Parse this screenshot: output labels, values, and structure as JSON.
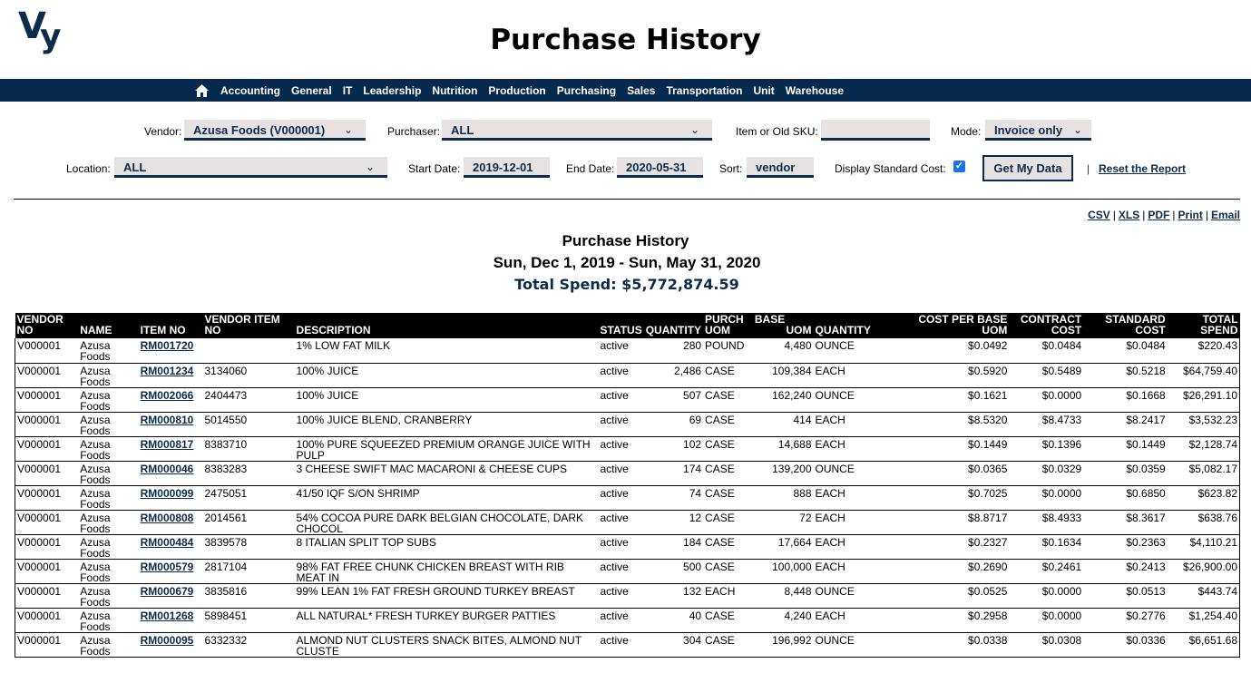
{
  "header": {
    "logo_text_v": "V",
    "logo_text_y": "y",
    "title": "Purchase History"
  },
  "nav": {
    "home_icon": "home-icon",
    "items": [
      "Accounting",
      "General",
      "IT",
      "Leadership",
      "Nutrition",
      "Production",
      "Purchasing",
      "Sales",
      "Transportation",
      "Unit",
      "Warehouse"
    ]
  },
  "filters": {
    "vendor_label": "Vendor:",
    "vendor_value": "Azusa Foods (V000001)",
    "purchaser_label": "Purchaser:",
    "purchaser_value": "ALL",
    "sku_label": "Item or Old SKU:",
    "sku_value": "",
    "mode_label": "Mode:",
    "mode_value": "Invoice only",
    "location_label": "Location:",
    "location_value": "ALL",
    "start_label": "Start Date:",
    "start_value": "2019-12-01",
    "end_label": "End Date:",
    "end_value": "2020-05-31",
    "sort_label": "Sort:",
    "sort_value": "vendor",
    "std_cost_label": "Display Standard Cost:",
    "std_cost_checked": true,
    "submit_label": "Get My Data",
    "separator": "|",
    "reset_label": "Reset the Report"
  },
  "exports": [
    "CSV",
    "XLS",
    "PDF",
    "Print",
    "Email"
  ],
  "report": {
    "title": "Purchase History",
    "range": "Sun, Dec 1, 2019 - Sun, May 31, 2020",
    "total": "Total Spend: $5,772,874.59"
  },
  "table": {
    "columns": [
      {
        "l1": "VENDOR",
        "l2": "NO"
      },
      {
        "l1": "",
        "l2": "NAME"
      },
      {
        "l1": "",
        "l2": "ITEM NO"
      },
      {
        "l1": "VENDOR ITEM",
        "l2": "NO"
      },
      {
        "l1": "",
        "l2": "DESCRIPTION"
      },
      {
        "l1": "",
        "l2": "STATUS"
      },
      {
        "l1": "",
        "l2": "QUANTITY"
      },
      {
        "l1": "PURCH",
        "l2": "UOM"
      },
      {
        "l1": "BASE",
        "l2": "UOM"
      },
      {
        "l1": "",
        "l2": "QUANTITY"
      },
      {
        "l1": "COST PER BASE",
        "l2": "UOM"
      },
      {
        "l1": "CONTRACT",
        "l2": "COST"
      },
      {
        "l1": "STANDARD",
        "l2": "COST"
      },
      {
        "l1": "TOTAL",
        "l2": "SPEND"
      }
    ],
    "rows": [
      {
        "vendor_no": "V000001",
        "name": "Azusa Foods",
        "item_no": "RM001720",
        "vendor_item_no": "",
        "description": "1% LOW FAT MILK",
        "status": "active",
        "quantity": "280",
        "purch_uom": "POUND",
        "base_uom": "4,480",
        "base_quantity": "OUNCE",
        "cost_per_base_uom": "$0.0492",
        "contract_cost": "$0.0484",
        "standard_cost": "$0.0484",
        "total_spend": "$220.43"
      },
      {
        "vendor_no": "V000001",
        "name": "Azusa Foods",
        "item_no": "RM001234",
        "vendor_item_no": "3134060",
        "description": "100% JUICE",
        "status": "active",
        "quantity": "2,486",
        "purch_uom": "CASE",
        "base_uom": "109,384",
        "base_quantity": "EACH",
        "cost_per_base_uom": "$0.5920",
        "contract_cost": "$0.5489",
        "standard_cost": "$0.5218",
        "total_spend": "$64,759.40"
      },
      {
        "vendor_no": "V000001",
        "name": "Azusa Foods",
        "item_no": "RM002066",
        "vendor_item_no": "2404473",
        "description": "100% JUICE",
        "status": "active",
        "quantity": "507",
        "purch_uom": "CASE",
        "base_uom": "162,240",
        "base_quantity": "OUNCE",
        "cost_per_base_uom": "$0.1621",
        "contract_cost": "$0.0000",
        "standard_cost": "$0.1668",
        "total_spend": "$26,291.10"
      },
      {
        "vendor_no": "V000001",
        "name": "Azusa Foods",
        "item_no": "RM000810",
        "vendor_item_no": "5014550",
        "description": "100% JUICE BLEND, CRANBERRY",
        "status": "active",
        "quantity": "69",
        "purch_uom": "CASE",
        "base_uom": "414",
        "base_quantity": "EACH",
        "cost_per_base_uom": "$8.5320",
        "contract_cost": "$8.4733",
        "standard_cost": "$8.2417",
        "total_spend": "$3,532.23"
      },
      {
        "vendor_no": "V000001",
        "name": "Azusa Foods",
        "item_no": "RM000817",
        "vendor_item_no": "8383710",
        "description": "100% PURE SQUEEZED PREMIUM ORANGE JUICE WITH PULP",
        "status": "active",
        "quantity": "102",
        "purch_uom": "CASE",
        "base_uom": "14,688",
        "base_quantity": "EACH",
        "cost_per_base_uom": "$0.1449",
        "contract_cost": "$0.1396",
        "standard_cost": "$0.1449",
        "total_spend": "$2,128.74"
      },
      {
        "vendor_no": "V000001",
        "name": "Azusa Foods",
        "item_no": "RM000046",
        "vendor_item_no": "8383283",
        "description": "3 CHEESE SWIFT MAC MACARONI & CHEESE CUPS",
        "status": "active",
        "quantity": "174",
        "purch_uom": "CASE",
        "base_uom": "139,200",
        "base_quantity": "OUNCE",
        "cost_per_base_uom": "$0.0365",
        "contract_cost": "$0.0329",
        "standard_cost": "$0.0359",
        "total_spend": "$5,082.17"
      },
      {
        "vendor_no": "V000001",
        "name": "Azusa Foods",
        "item_no": "RM000099",
        "vendor_item_no": "2475051",
        "description": "41/50 IQF S/ON SHRIMP",
        "status": "active",
        "quantity": "74",
        "purch_uom": "CASE",
        "base_uom": "888",
        "base_quantity": "EACH",
        "cost_per_base_uom": "$0.7025",
        "contract_cost": "$0.0000",
        "standard_cost": "$0.6850",
        "total_spend": "$623.82"
      },
      {
        "vendor_no": "V000001",
        "name": "Azusa Foods",
        "item_no": "RM000808",
        "vendor_item_no": "2014561",
        "description": "54% COCOA PURE DARK BELGIAN CHOCOLATE, DARK CHOCOL",
        "status": "active",
        "quantity": "12",
        "purch_uom": "CASE",
        "base_uom": "72",
        "base_quantity": "EACH",
        "cost_per_base_uom": "$8.8717",
        "contract_cost": "$8.4933",
        "standard_cost": "$8.3617",
        "total_spend": "$638.76"
      },
      {
        "vendor_no": "V000001",
        "name": "Azusa Foods",
        "item_no": "RM000484",
        "vendor_item_no": "3839578",
        "description": "8 ITALIAN SPLIT TOP SUBS",
        "status": "active",
        "quantity": "184",
        "purch_uom": "CASE",
        "base_uom": "17,664",
        "base_quantity": "EACH",
        "cost_per_base_uom": "$0.2327",
        "contract_cost": "$0.1634",
        "standard_cost": "$0.2363",
        "total_spend": "$4,110.21"
      },
      {
        "vendor_no": "V000001",
        "name": "Azusa Foods",
        "item_no": "RM000579",
        "vendor_item_no": "2817104",
        "description": "98% FAT FREE CHUNK CHICKEN BREAST WITH RIB MEAT IN",
        "status": "active",
        "quantity": "500",
        "purch_uom": "CASE",
        "base_uom": "100,000",
        "base_quantity": "EACH",
        "cost_per_base_uom": "$0.2690",
        "contract_cost": "$0.2461",
        "standard_cost": "$0.2413",
        "total_spend": "$26,900.00"
      },
      {
        "vendor_no": "V000001",
        "name": "Azusa Foods",
        "item_no": "RM000679",
        "vendor_item_no": "3835816",
        "description": "99% LEAN 1% FAT FRESH GROUND TURKEY BREAST",
        "status": "active",
        "quantity": "132",
        "purch_uom": "EACH",
        "base_uom": "8,448",
        "base_quantity": "OUNCE",
        "cost_per_base_uom": "$0.0525",
        "contract_cost": "$0.0000",
        "standard_cost": "$0.0513",
        "total_spend": "$443.74"
      },
      {
        "vendor_no": "V000001",
        "name": "Azusa Foods",
        "item_no": "RM001268",
        "vendor_item_no": "5898451",
        "description": "ALL NATURAL* FRESH TURKEY BURGER PATTIES",
        "status": "active",
        "quantity": "40",
        "purch_uom": "CASE",
        "base_uom": "4,240",
        "base_quantity": "EACH",
        "cost_per_base_uom": "$0.2958",
        "contract_cost": "$0.0000",
        "standard_cost": "$0.2776",
        "total_spend": "$1,254.40"
      },
      {
        "vendor_no": "V000001",
        "name": "Azusa Foods",
        "item_no": "RM000095",
        "vendor_item_no": "6332332",
        "description": "ALMOND NUT CLUSTERS SNACK BITES, ALMOND NUT CLUSTE",
        "status": "active",
        "quantity": "304",
        "purch_uom": "CASE",
        "base_uom": "196,992",
        "base_quantity": "OUNCE",
        "cost_per_base_uom": "$0.0338",
        "contract_cost": "$0.0308",
        "standard_cost": "$0.0336",
        "total_spend": "$6,651.68"
      }
    ]
  }
}
